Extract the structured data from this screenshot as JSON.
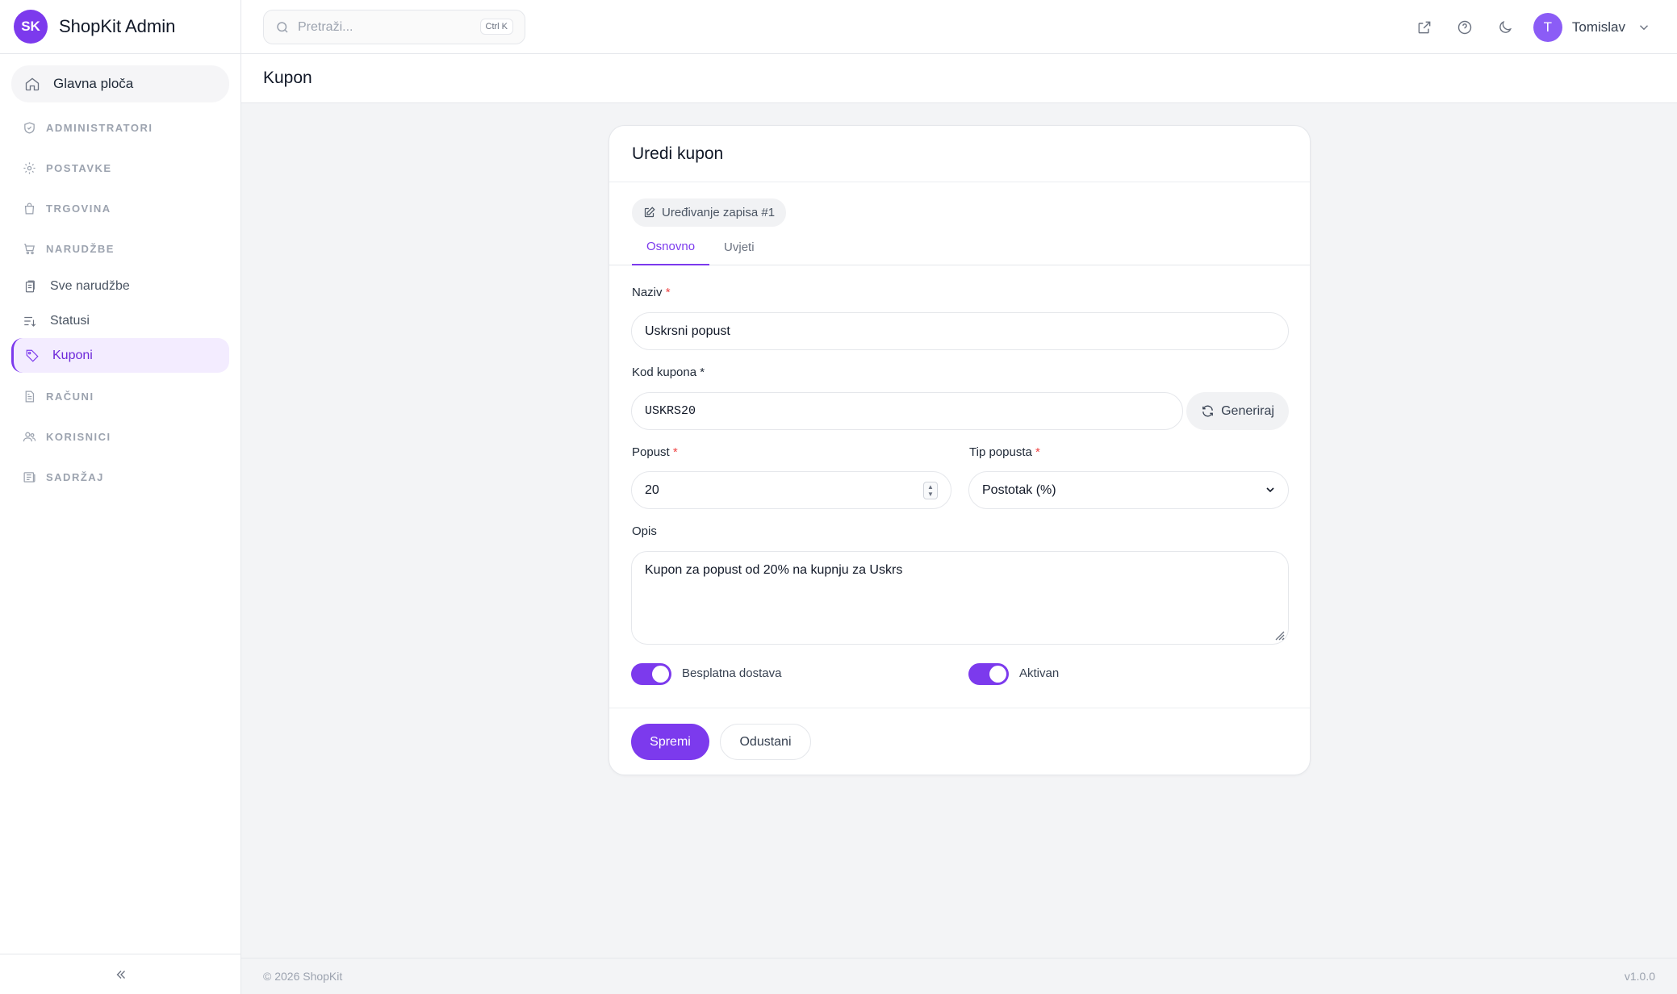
{
  "brand": {
    "initials": "SK",
    "name": "ShopKit Admin"
  },
  "sidebar": {
    "home": "Glavna ploča",
    "groups": {
      "admins": "ADMINISTRATORI",
      "settings": "POSTAVKE",
      "shop": "TRGOVINA",
      "orders": "NARUDŽBE",
      "invoices": "RAČUNI",
      "users": "KORISNICI",
      "content": "SADRŽAJ"
    },
    "order_items": [
      "Sve narudžbe",
      "Statusi",
      "Kuponi"
    ],
    "active_item": "Kuponi"
  },
  "topbar": {
    "search_placeholder": "Pretraži...",
    "search_shortcut": "Ctrl K",
    "user_initial": "T",
    "user_name": "Tomislav"
  },
  "page": {
    "title": "Kupon"
  },
  "form": {
    "card_title": "Uredi kupon",
    "record_badge": "Uređivanje zapisa #1",
    "tabs": [
      "Osnovno",
      "Uvjeti"
    ],
    "active_tab": "Osnovno",
    "required_mark": "*",
    "name_label": "Naziv",
    "name_value": "Uskrsni popust",
    "code_label": "Kod kupona",
    "code_value": "USKRS20",
    "generate_label": "Generiraj",
    "discount_label": "Popust",
    "discount_value": "20",
    "discount_type_label": "Tip popusta",
    "discount_type_value": "Postotak (%)",
    "description_label": "Opis",
    "description_value": "Kupon za popust od 20% na kupnju za Uskrs",
    "free_shipping_label": "Besplatna dostava",
    "free_shipping_on": true,
    "active_label": "Aktivan",
    "active_on": true,
    "save_label": "Spremi",
    "cancel_label": "Odustani"
  },
  "footer": {
    "copyright": "© 2026 ShopKit",
    "version": "v1.0.0"
  },
  "colors": {
    "accent": "#7c3aed",
    "required": "#ef4444"
  }
}
